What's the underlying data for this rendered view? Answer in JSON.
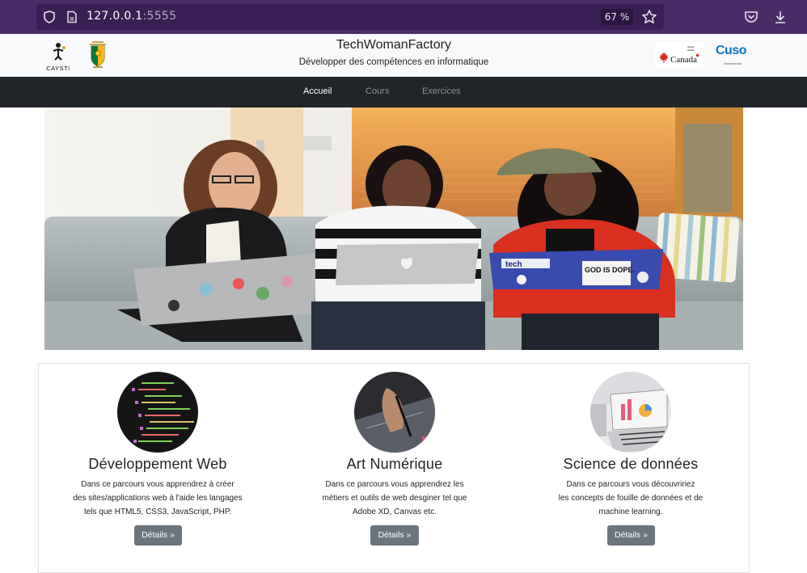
{
  "browser": {
    "url_host": "127.0.0.1",
    "url_port": ":5555",
    "zoom": "67 %"
  },
  "header": {
    "title": "TechWomanFactory",
    "subtitle": "Développer des compétences en informatique",
    "logo_left_text": "CAYSTI",
    "logo_canada_text": "Canada",
    "logo_cuso_text": "Cuso",
    "logo_cuso_sub": "International"
  },
  "nav": {
    "items": [
      {
        "label": "Accueil",
        "active": true
      },
      {
        "label": "Cours",
        "active": false
      },
      {
        "label": "Exercices",
        "active": false
      }
    ]
  },
  "hero": {
    "laptop_sticker_1": "tech",
    "laptop_sticker_2": "GOD IS DOPE."
  },
  "cards": [
    {
      "title": "Développement Web",
      "text_lines": [
        "Dans ce parcours vous apprendrez à créer",
        "des sites/applications web à l'aide les langages",
        "tels que HTML5, CSS3, JavaScript, PHP."
      ],
      "button": "Détails »"
    },
    {
      "title": "Art Numérique",
      "text_lines": [
        "Dans ce parcours vous apprendrez les",
        "métiers et outils de web desginer tel que",
        "Adobe XD, Canvas etc."
      ],
      "button": "Détails »"
    },
    {
      "title": "Science de données",
      "text_lines": [
        "Dans ce parcours vous découvririez",
        "les concepts de fouille de données et de",
        "machine learning."
      ],
      "button": "Détails »"
    }
  ],
  "colors": {
    "browser_chrome": "#4a2c66",
    "navbar": "#212529",
    "button": "#6c757d"
  }
}
